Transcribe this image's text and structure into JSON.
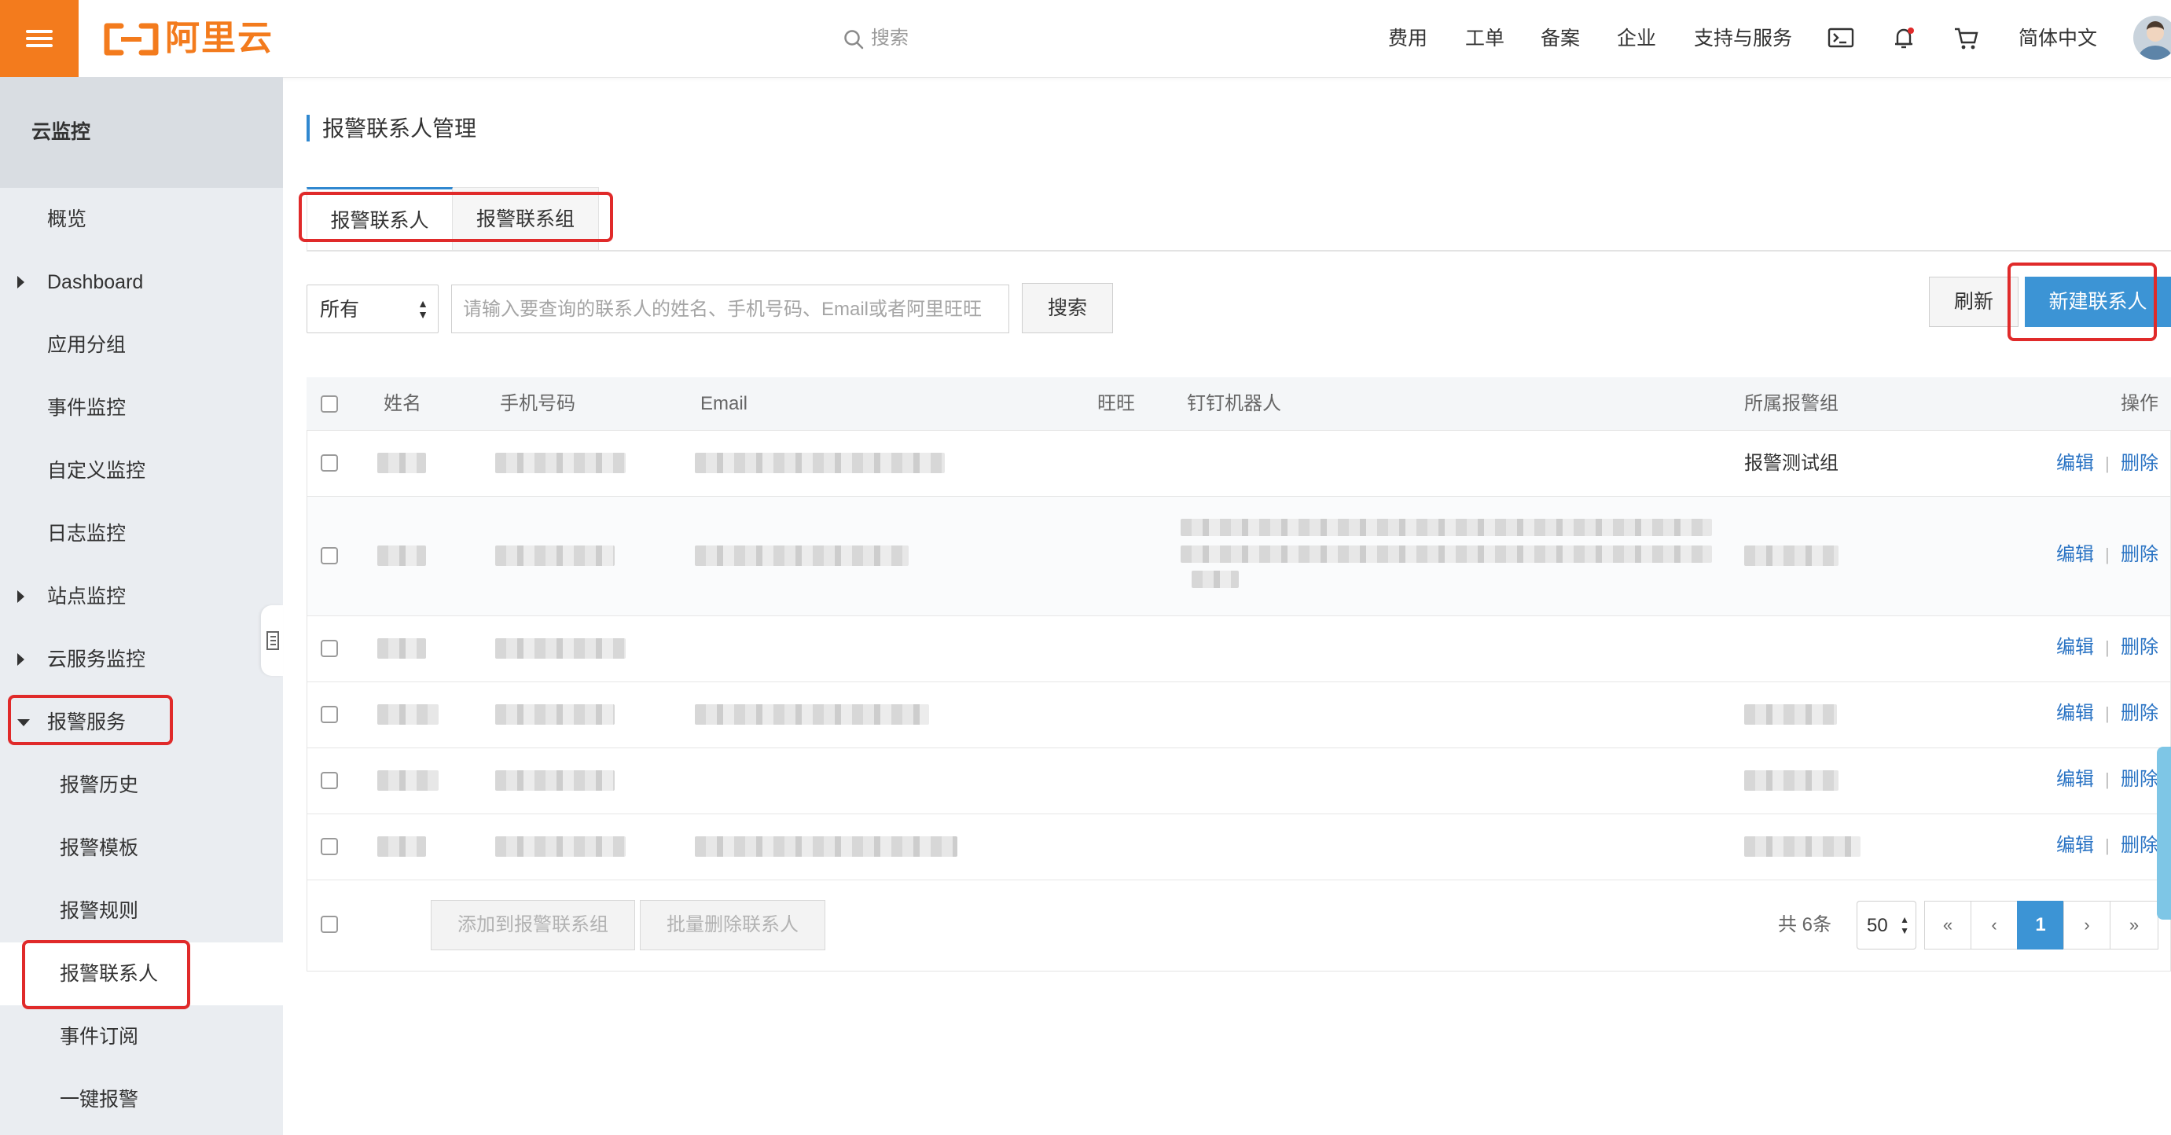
{
  "header": {
    "logo_text": "阿里云",
    "search_placeholder": "搜索",
    "nav": [
      "费用",
      "工单",
      "备案",
      "企业",
      "支持与服务"
    ],
    "language": "简体中文"
  },
  "sidebar": {
    "title": "云监控",
    "items": [
      {
        "label": "概览"
      },
      {
        "label": "Dashboard"
      },
      {
        "label": "应用分组"
      },
      {
        "label": "事件监控"
      },
      {
        "label": "自定义监控"
      },
      {
        "label": "日志监控"
      },
      {
        "label": "站点监控"
      },
      {
        "label": "云服务监控"
      },
      {
        "label": "报警服务"
      },
      {
        "label": "报警历史"
      },
      {
        "label": "报警模板"
      },
      {
        "label": "报警规则"
      },
      {
        "label": "报警联系人"
      },
      {
        "label": "事件订阅"
      },
      {
        "label": "一键报警"
      }
    ]
  },
  "main": {
    "title": "报警联系人管理",
    "tabs": [
      "报警联系人",
      "报警联系组"
    ],
    "filter_value": "所有",
    "search_placeholder": "请输入要查询的联系人的姓名、手机号码、Email或者阿里旺旺",
    "search_button": "搜索",
    "refresh_button": "刷新",
    "new_button": "新建联系人",
    "columns": [
      "姓名",
      "手机号码",
      "Email",
      "旺旺",
      "钉钉机器人",
      "所属报警组",
      "操作"
    ],
    "rows": [
      {
        "group": "报警测试组",
        "edit": "编辑",
        "delete": "删除"
      },
      {
        "group": "",
        "edit": "编辑",
        "delete": "删除"
      },
      {
        "group": "",
        "edit": "编辑",
        "delete": "删除"
      },
      {
        "group": "",
        "edit": "编辑",
        "delete": "删除"
      },
      {
        "group": "",
        "edit": "编辑",
        "delete": "删除"
      },
      {
        "group": "",
        "edit": "编辑",
        "delete": "删除"
      }
    ],
    "footer": {
      "add_to_group": "添加到报警联系组",
      "batch_delete": "批量删除联系人",
      "total": "共 6条",
      "page_size": "50",
      "pager": [
        "«",
        "‹",
        "1",
        "›",
        "»"
      ]
    }
  },
  "colors": {
    "brand_orange": "#f37b1d",
    "primary_blue": "#3c94d5",
    "link_blue": "#2b74c4",
    "highlight_red": "#e02a2a"
  }
}
